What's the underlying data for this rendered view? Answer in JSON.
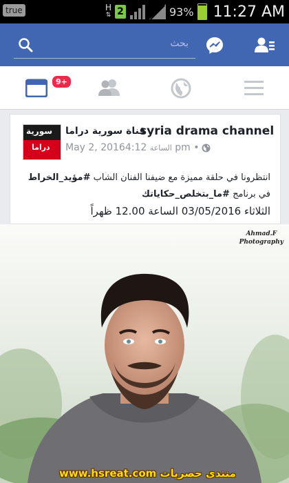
{
  "status_bar": {
    "app_badge": "true",
    "network_type": "H",
    "sim_slot": "2",
    "battery_percent": "93%",
    "battery_level": 0.93,
    "time": "11:27 AM"
  },
  "header": {
    "search_placeholder": "بحث",
    "icons": [
      "search-icon",
      "messenger-icon",
      "friend-requests-icon"
    ],
    "color": "#4267b2"
  },
  "tabs": {
    "items": [
      "news-feed-icon",
      "friends-icon",
      "globe-icon",
      "menu-icon"
    ],
    "news_feed_badge": "9+",
    "active_color": "#4267b2"
  },
  "post": {
    "avatar_text_top": "سورية",
    "avatar_text_bottom": "دراما",
    "page_name": "syria drama channel",
    "page_name_arabic": "قناة سورية دراما",
    "date": "May 2, 2016",
    "time_prefix": "الساعة",
    "time": "4:12 pm",
    "separator": "•",
    "text_line1_prefix": "انتظرونا في حلقة مميزة مع ضيفنا الفنان الشاب",
    "text_line1_hashtag": "#مؤيد_الخراط",
    "text_line2_prefix": "في برنامج",
    "text_line2_hashtag": "#ما_بتخلص_حكاياتك",
    "text_line3": "الثلاثاء 03/05/2016 الساعة 12.00 ظهراً"
  },
  "photo": {
    "credit_line1": "Ahmad.F",
    "credit_line2": "Photography",
    "watermark": "www.hsreat.com منتدى حصريات"
  }
}
